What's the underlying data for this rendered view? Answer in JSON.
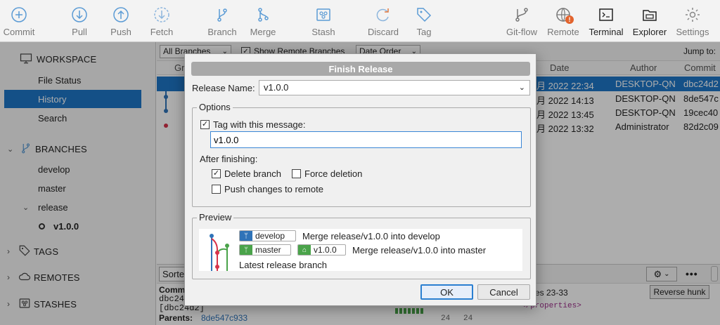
{
  "toolbar": {
    "commit": "Commit",
    "pull": "Pull",
    "push": "Push",
    "fetch": "Fetch",
    "branch": "Branch",
    "merge": "Merge",
    "stash": "Stash",
    "discard": "Discard",
    "tag": "Tag",
    "gitflow": "Git-flow",
    "remote": "Remote",
    "terminal": "Terminal",
    "explorer": "Explorer",
    "settings": "Settings"
  },
  "sidebar": {
    "workspace": "WORKSPACE",
    "file_status": "File Status",
    "history": "History",
    "search": "Search",
    "branches": "BRANCHES",
    "develop": "develop",
    "master": "master",
    "release": "release",
    "release_child": "v1.0.0",
    "tags": "TAGS",
    "remotes": "REMOTES",
    "stashes": "STASHES"
  },
  "main": {
    "branch_filter": "All Branches",
    "show_remote": "Show Remote Branches",
    "order": "Date Order",
    "jump_to": "Jump to:",
    "col_graph": "Gr",
    "col_date": "Date",
    "col_author": "Author",
    "col_commit": "Commit",
    "rows": [
      {
        "date": "月 2022 22:34",
        "author": "DESKTOP-QN",
        "commit": "dbc24d2"
      },
      {
        "date": "月 2022 14:13",
        "author": "DESKTOP-QN",
        "commit": "8de547c"
      },
      {
        "date": "月 2022 13:45",
        "author": "DESKTOP-QN",
        "commit": "19cec40"
      },
      {
        "date": "月 2022 13:32",
        "author": "Administrator",
        "commit": "82d2c09"
      }
    ],
    "sort_label": "Sorte",
    "lines_label": "es 23-33",
    "reverse_hunk": "Reverse hunk",
    "detail_commit": "Comm",
    "detail_hash1": "dbc24",
    "detail_hash2": "[dbc24d2]",
    "parents_label": "Parents:",
    "parents_value": "8de547c933",
    "line_num1": "24",
    "line_num2": "24",
    "code_text": "</properties>"
  },
  "dialog": {
    "title": "Finish Release",
    "release_name_label": "Release Name:",
    "release_name_value": "v1.0.0",
    "options_legend": "Options",
    "tag_with_message": "Tag with this message:",
    "tag_message_value": "v1.0.0",
    "after_finishing": "After finishing:",
    "delete_branch": "Delete branch",
    "force_deletion": "Force deletion",
    "push_changes": "Push changes to remote",
    "preview_legend": "Preview",
    "preview_develop": "develop",
    "preview_merge_develop": "Merge release/v1.0.0 into develop",
    "preview_master": "master",
    "preview_tag": "v1.0.0",
    "preview_merge_master": "Merge release/v1.0.0 into master",
    "preview_latest": "Latest release branch",
    "ok": "OK",
    "cancel": "Cancel"
  },
  "colors": {
    "accent": "#1e76c7",
    "branch_blue": "#2f73b8",
    "branch_green": "#4aa34a",
    "graph_red": "#d6334a"
  }
}
